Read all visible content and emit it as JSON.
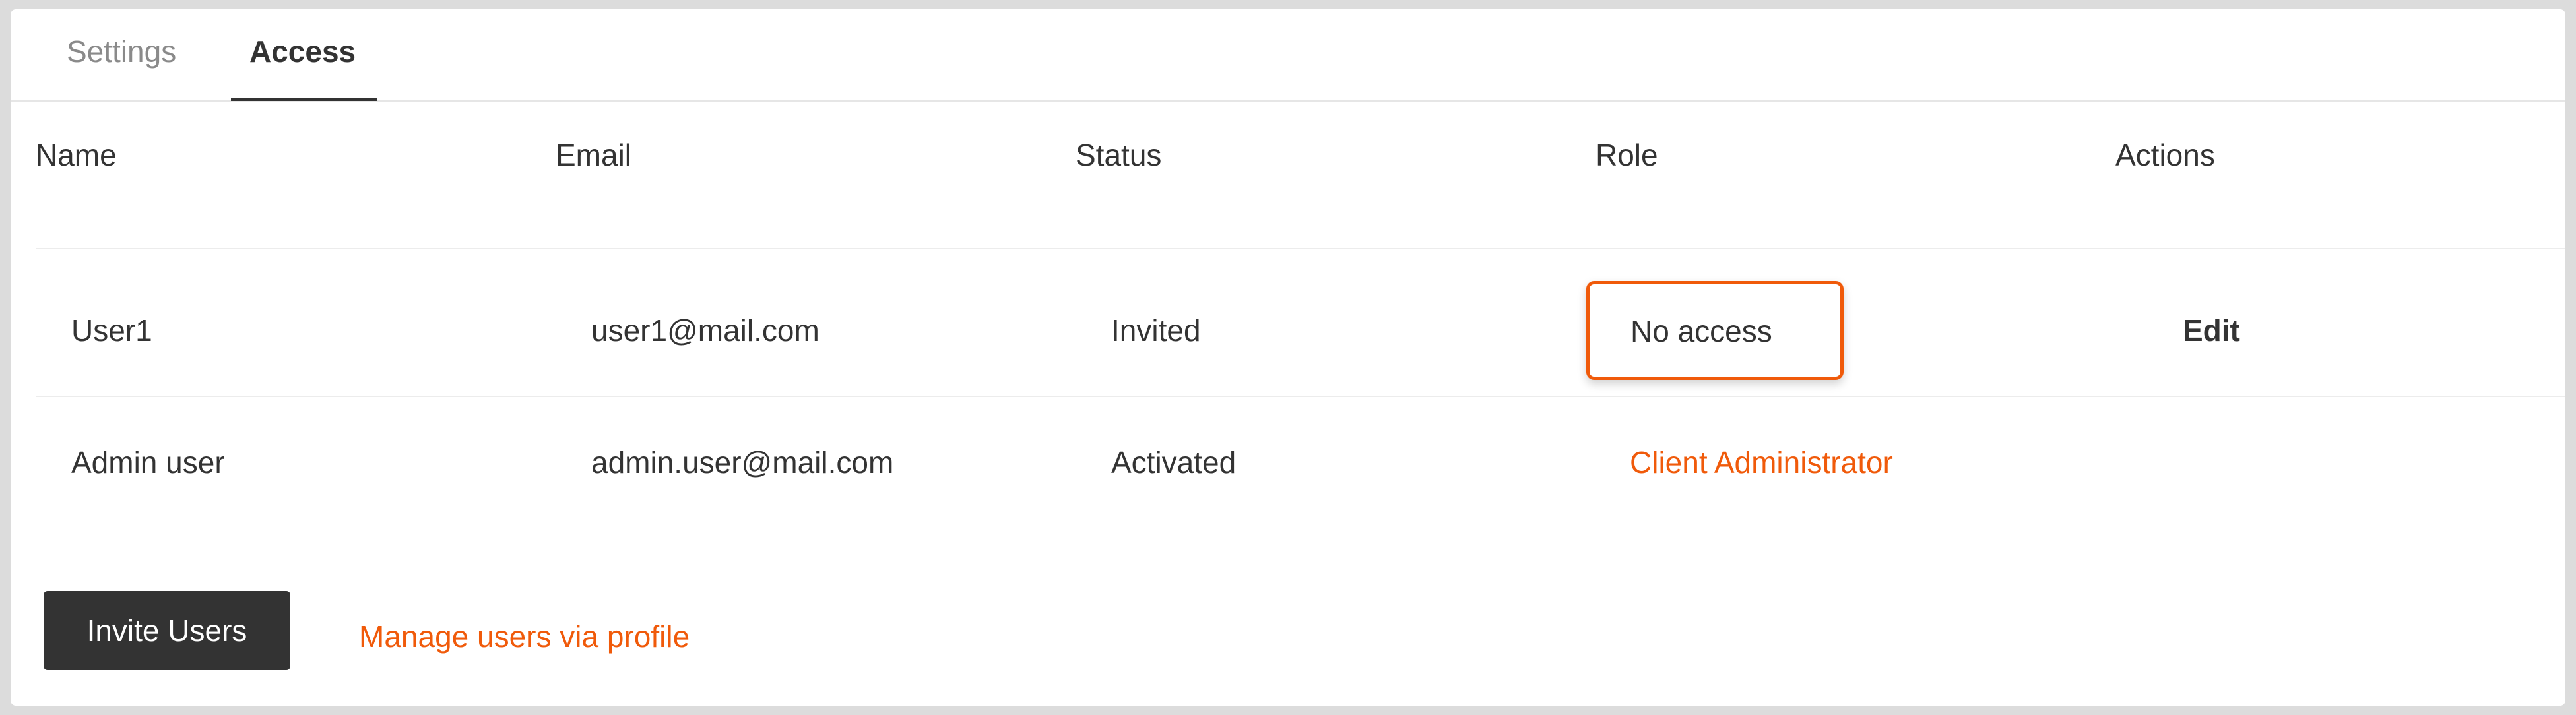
{
  "tabs": [
    {
      "label": "Settings",
      "active": false
    },
    {
      "label": "Access",
      "active": true
    }
  ],
  "table": {
    "columns": [
      "Name",
      "Email",
      "Status",
      "Role",
      "Actions"
    ],
    "rows": [
      {
        "name": "User1",
        "email": "user1@mail.com",
        "status": "Invited",
        "role": "No access",
        "action": "Edit"
      },
      {
        "name": "Admin user",
        "email": "admin.user@mail.com",
        "status": "Activated",
        "role": "Client Administrator",
        "action": ""
      }
    ]
  },
  "footer": {
    "invite_label": "Invite Users",
    "manage_label": "Manage users via profile"
  },
  "colors": {
    "accent": "#f05a0a",
    "dark": "#333333",
    "muted": "#8a8a8a"
  }
}
